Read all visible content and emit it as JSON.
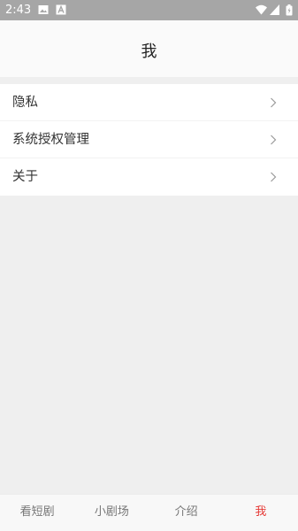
{
  "status_bar": {
    "time": "2:43",
    "left_icons": [
      "image-icon",
      "a-icon"
    ],
    "right_icons": [
      "wifi-icon",
      "signal-icon",
      "battery-icon"
    ]
  },
  "header": {
    "title": "我"
  },
  "menu": {
    "items": [
      {
        "label": "隐私",
        "icon": "chevron-right-icon"
      },
      {
        "label": "系统授权管理",
        "icon": "chevron-right-icon"
      },
      {
        "label": "关于",
        "icon": "chevron-right-icon"
      }
    ]
  },
  "tabbar": {
    "tabs": [
      {
        "label": "看短剧"
      },
      {
        "label": "小剧场"
      },
      {
        "label": "介绍"
      },
      {
        "label": "我"
      }
    ],
    "active_index": 3,
    "active_color": "#e53935"
  },
  "colors": {
    "page_background": "#efefef",
    "status_bar": "#a6a6a6",
    "header": "#fafafa"
  }
}
